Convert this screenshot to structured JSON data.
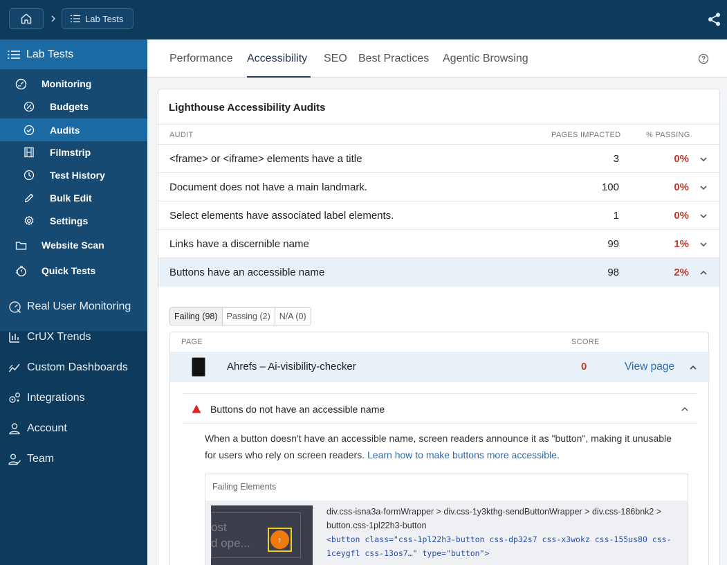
{
  "topbar": {
    "breadcrumb_label": "Lab Tests",
    "icons": [
      "home-icon",
      "chevron-right-icon",
      "list-icon",
      "share-icon"
    ]
  },
  "sidebar": {
    "header": "Lab Tests",
    "monitoring": "Monitoring",
    "items": [
      {
        "label": "Budgets",
        "icon": "budget-icon"
      },
      {
        "label": "Audits",
        "icon": "check-circle-icon",
        "active": true
      },
      {
        "label": "Filmstrip",
        "icon": "filmstrip-icon"
      },
      {
        "label": "Test History",
        "icon": "clock-icon"
      },
      {
        "label": "Bulk Edit",
        "icon": "pencil-icon"
      },
      {
        "label": "Settings",
        "icon": "gear-icon"
      }
    ],
    "website_scan": "Website Scan",
    "quick_tests": "Quick Tests",
    "nav": [
      {
        "label": "Real User Monitoring",
        "icon": "rum-icon"
      },
      {
        "label": "CrUX Trends",
        "icon": "bar-chart-icon"
      },
      {
        "label": "Custom Dashboards",
        "icon": "trend-icon"
      },
      {
        "label": "Integrations",
        "icon": "integrations-icon"
      },
      {
        "label": "Account",
        "icon": "user-icon"
      },
      {
        "label": "Team",
        "icon": "team-icon"
      }
    ]
  },
  "tabs": [
    "Performance",
    "Accessibility",
    "SEO",
    "Best Practices",
    "Agentic Browsing"
  ],
  "active_tab": "Accessibility",
  "card": {
    "title": "Lighthouse Accessibility Audits",
    "columns": {
      "audit": "AUDIT",
      "pages": "PAGES IMPACTED",
      "passing": "% PASSING"
    },
    "audits": [
      {
        "name": "<frame> or <iframe> elements have a title",
        "pages": "3",
        "passing": "0%"
      },
      {
        "name": "Document does not have a main landmark.",
        "pages": "100",
        "passing": "0%"
      },
      {
        "name": "Select elements have associated label elements.",
        "pages": "1",
        "passing": "0%"
      },
      {
        "name": "Links have a discernible name",
        "pages": "99",
        "passing": "1%"
      },
      {
        "name": "Buttons have an accessible name",
        "pages": "98",
        "passing": "2%"
      }
    ],
    "subtabs": [
      "Failing (98)",
      "Passing (2)",
      "N/A (0)"
    ],
    "pages_table": {
      "col_page": "PAGE",
      "col_score": "SCORE",
      "row": {
        "name": "Ahrefs – Ai-visibility-checker",
        "score": "0",
        "link": "View page"
      }
    },
    "issue": {
      "title": "Buttons do not have an accessible name",
      "desc": "When a button doesn't have an accessible name, screen readers announce it as \"button\", making it unusable for users who rely on screen readers.",
      "link": "Learn how to make buttons more accessible",
      "link_after": "."
    },
    "failing": {
      "title": "Failing Elements",
      "thumb_line1": "ost",
      "thumb_line2": "d ope...",
      "selector": "div.css-isna3a-formWrapper > div.css-1y3kthg-sendButtonWrapper > div.css-186bnk2 > button.css-1pl22h3-button",
      "code": "<button class=\"css-1pl22h3-button css-dp32s7 css-x3wokz css-155us80 css-1ceygfl css-13os7…\" type=\"button\">"
    }
  },
  "colors": {
    "nav_bg": "#0e3a5c",
    "active": "#1b6aa3",
    "fail": "#c0392b",
    "link": "#2b6cb0"
  }
}
